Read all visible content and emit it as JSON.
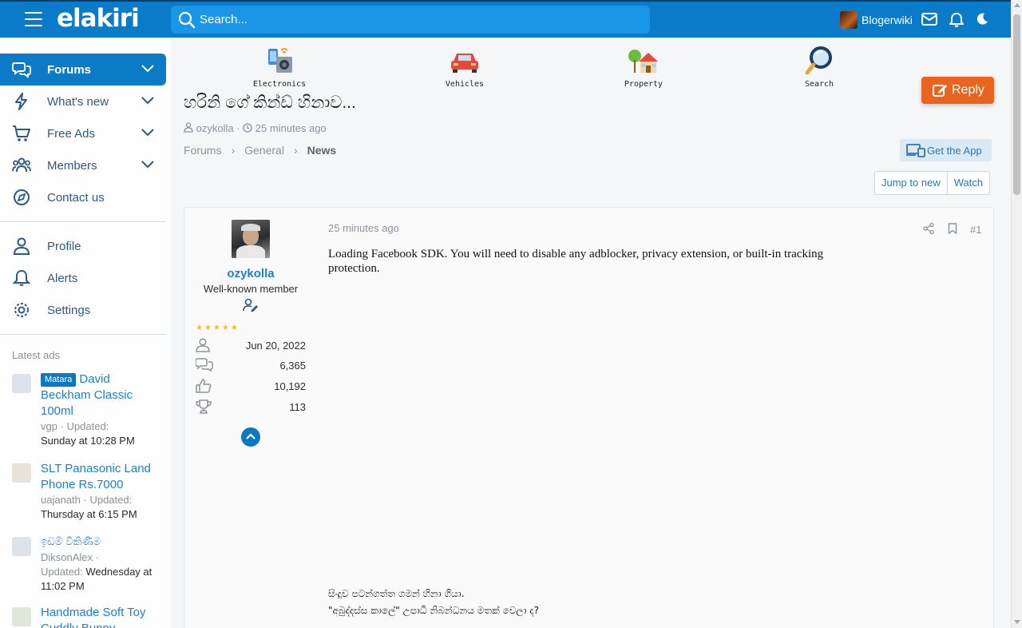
{
  "header": {
    "logo": "elakiri",
    "search_placeholder": "Search...",
    "username": "Blogerwiki"
  },
  "sidebar": {
    "nav": [
      {
        "label": "Forums"
      },
      {
        "label": "What's new"
      },
      {
        "label": "Free Ads"
      },
      {
        "label": "Members"
      },
      {
        "label": "Contact us"
      }
    ],
    "account": [
      {
        "label": "Profile"
      },
      {
        "label": "Alerts"
      },
      {
        "label": "Settings"
      }
    ],
    "latest_ads_title": "Latest ads",
    "ads": [
      {
        "badge": "Matara",
        "title": "David Beckham Classic 100ml",
        "user": "vgp",
        "updated_prefix": "Updated:",
        "updated": "Sunday at 10:28 PM"
      },
      {
        "title": "SLT Panasonic Land Phone Rs.7000",
        "user": "uajanath",
        "updated_prefix": "Updated:",
        "updated": "Thursday at 6:15 PM"
      },
      {
        "title": "ඉඩම් විකිණීම",
        "user": "DiksonAlex",
        "updated_prefix": "Updated:",
        "updated": "Wednesday at 11:02 PM"
      },
      {
        "title": "Handmade Soft Toy Cuddly Bunny"
      }
    ]
  },
  "categories": [
    {
      "label": "Electronics",
      "icon": "electronics-icon"
    },
    {
      "label": "Vehicles",
      "icon": "car-icon"
    },
    {
      "label": "Property",
      "icon": "house-icon"
    },
    {
      "label": "Search",
      "icon": "magnifier-icon"
    }
  ],
  "thread": {
    "title": "හරිනි ගේ කින්ඩ් හිනාව...",
    "author": "ozykolla",
    "time": "25 minutes ago",
    "breadcrumbs": [
      "Forums",
      "General",
      "News"
    ]
  },
  "buttons": {
    "reply": "Reply",
    "get_app": "Get the App",
    "jump_to_new": "Jump to new",
    "watch": "Watch"
  },
  "post": {
    "username": "ozykolla",
    "user_title": "Well-known member",
    "stars": "★★★★★",
    "joined": "Jun 20, 2022",
    "messages": "6,365",
    "reactions": "10,192",
    "points": "113",
    "time": "25 minutes ago",
    "number": "#1",
    "body": "Loading Facebook SDK. You will need to disable any adblocker, privacy extension, or built-in tracking protection.",
    "footer_line1": "සිංදුව පටන්ගත්ත ගමන් හිනා ගියා.",
    "footer_line2": "\"අබුද්දස්ස කාලේ\" උපාධි නිබන්ධනය මතක් වෙලා ද?"
  },
  "colors": {
    "brand": "#0a7bc9",
    "accent": "#e8641f",
    "link": "#1b7fd0"
  }
}
